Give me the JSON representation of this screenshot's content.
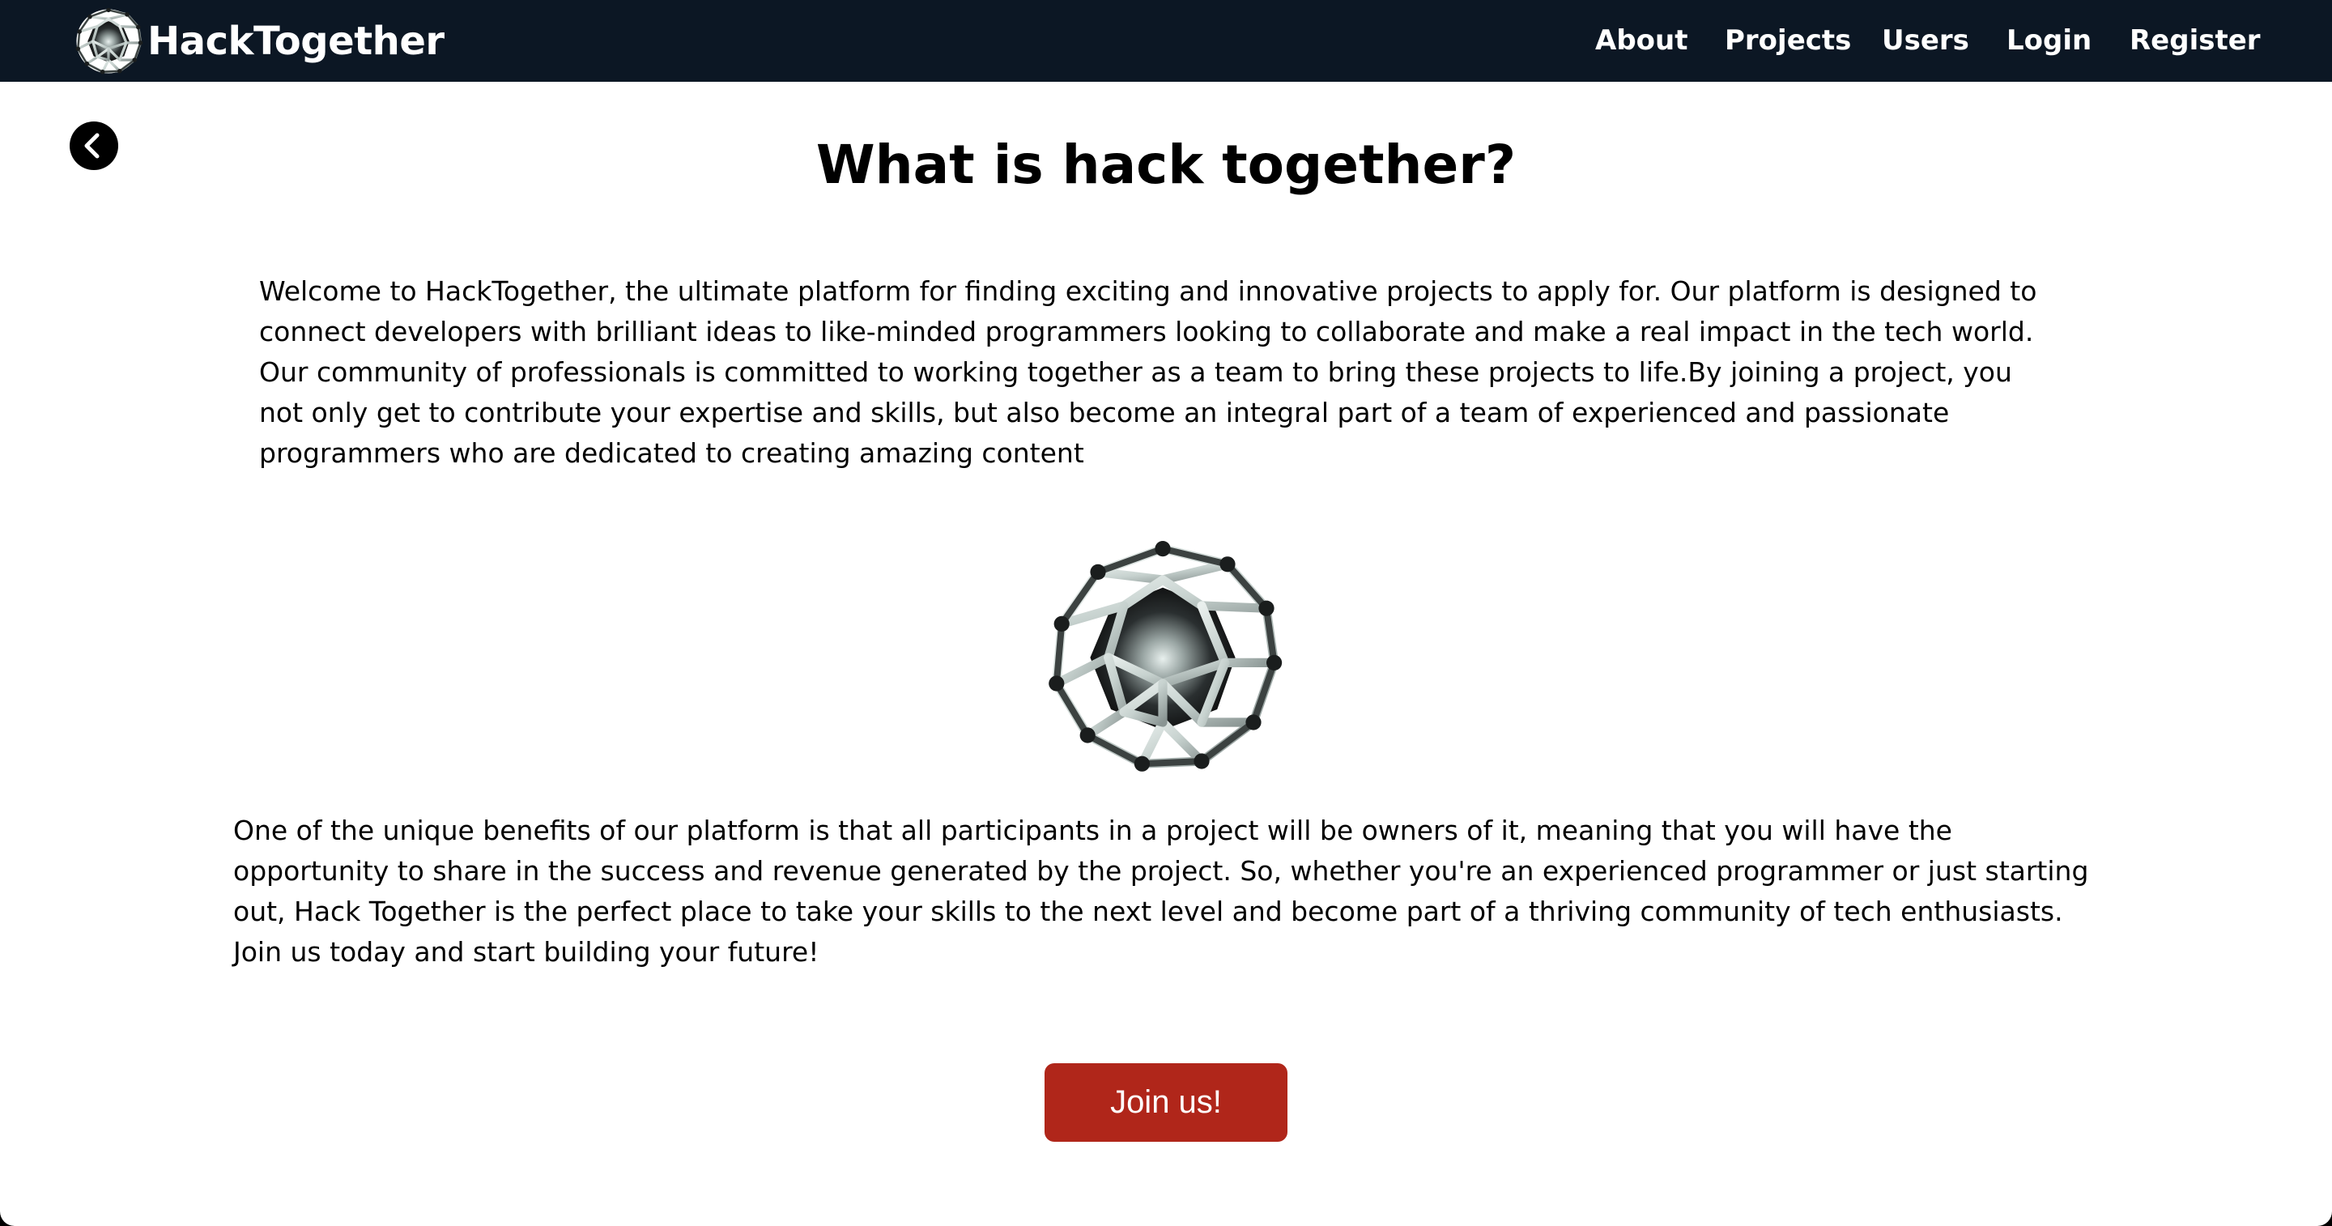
{
  "navbar": {
    "brand_name": "HackTogether",
    "links": {
      "about": "About",
      "projects": "Projects",
      "users": "Users",
      "login": "Login",
      "register": "Register"
    },
    "background_color": "#0c1724"
  },
  "main": {
    "title": "What is hack together?",
    "intro": "Welcome to HackTogether, the ultimate platform for finding exciting and innovative projects to apply for. Our platform is designed to connect developers with brilliant ideas to like-minded programmers looking to collaborate and make a real impact in the tech world. Our community of professionals is committed to working together as a team to bring these projects to life.By joining a project, you not only get to contribute your expertise and skills, but also become an integral part of a team of experienced and passionate programmers who are dedicated to creating amazing content",
    "benefits": "One of the unique benefits of our platform is that all participants in a project will be owners of it, meaning that you will have the opportunity to share in the success and revenue generated by the project. So, whether you're an experienced programmer or just starting out, Hack Together is the perfect place to take your skills to the next level and become part of a thriving community of tech enthusiasts. Join us today and start building your future!",
    "join_button": "Join us!",
    "join_button_color": "#b0261a"
  },
  "icons": {
    "back": "chevron-left-icon",
    "logo": "geodesic-sphere-logo"
  }
}
